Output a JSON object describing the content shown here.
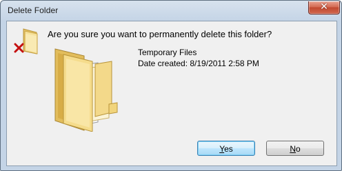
{
  "window": {
    "title": "Delete Folder",
    "close_glyph": "✕"
  },
  "dialog": {
    "prompt": "Are you sure you want to permanently delete this folder?",
    "folder_name": "Temporary Files",
    "date_created": "Date created: 8/19/2011 2:58 PM"
  },
  "buttons": {
    "yes_accel": "Y",
    "yes_rest": "es",
    "no_accel": "N",
    "no_rest": "o"
  },
  "icons": {
    "small": "folder-delete-icon",
    "large": "open-folder-icon",
    "close": "close-icon"
  },
  "colors": {
    "folder": "#f3d98a",
    "folder_dark": "#d8b04e",
    "delete_x": "#c41010",
    "close_button": "#c8553d",
    "default_button_border": "#3c7fb1"
  }
}
